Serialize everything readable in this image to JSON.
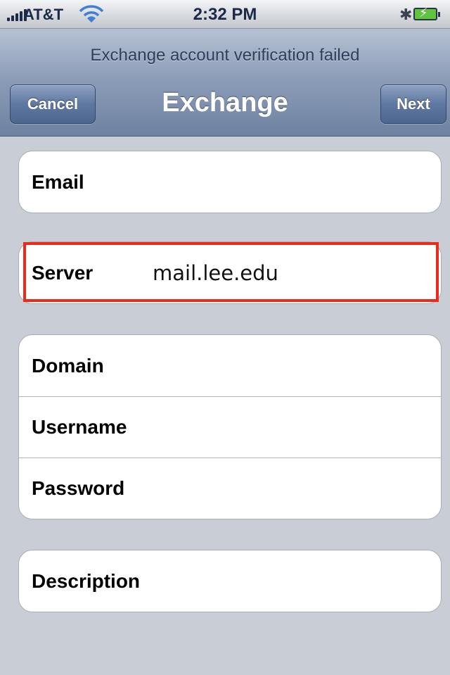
{
  "status_bar": {
    "carrier": "AT&T",
    "time": "2:32 PM",
    "icons": [
      "signal-bars-icon",
      "wifi-icon",
      "bluetooth-icon",
      "battery-charging-icon"
    ]
  },
  "nav": {
    "prompt": "Exchange account verification failed",
    "title": "Exchange",
    "cancel_label": "Cancel",
    "next_label": "Next"
  },
  "form": {
    "email": {
      "label": "Email",
      "value": ""
    },
    "server": {
      "label": "Server",
      "value": "mail.lee.edu",
      "highlighted": true,
      "highlight_color": "#ec2a19"
    },
    "domain": {
      "label": "Domain",
      "value": ""
    },
    "username": {
      "label": "Username",
      "value": ""
    },
    "password": {
      "label": "Password",
      "value": ""
    },
    "description": {
      "label": "Description",
      "value": ""
    }
  }
}
